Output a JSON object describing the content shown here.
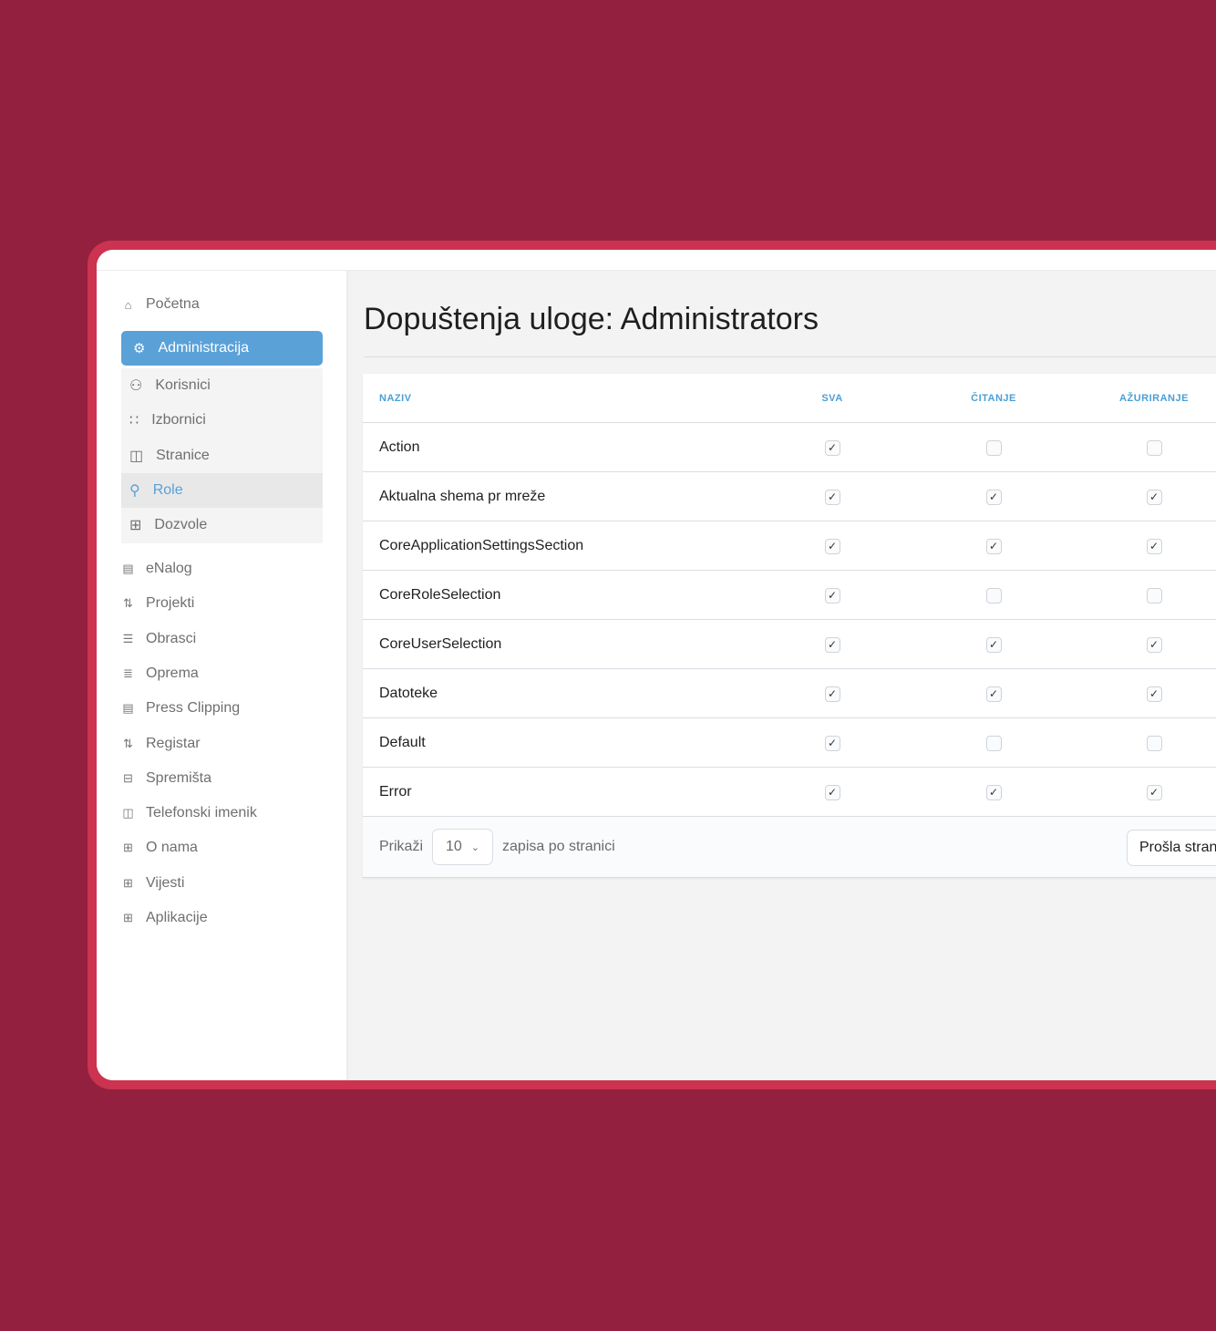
{
  "colors": {
    "background": "#93203e",
    "frame": "#cc3350",
    "accent": "#5aa1d8"
  },
  "sidebar": {
    "home": {
      "label": "Početna",
      "icon": "home-icon"
    },
    "active": {
      "label": "Administracija",
      "icon": "gear-icon"
    },
    "sub": [
      {
        "label": "Korisnici",
        "icon": "users-icon"
      },
      {
        "label": "Izbornici",
        "icon": "circles-grid-icon"
      },
      {
        "label": "Stranice",
        "icon": "book-icon"
      },
      {
        "label": "Role",
        "icon": "user-gear-icon",
        "selected": true
      },
      {
        "label": "Dozvole",
        "icon": "grid-icon"
      }
    ],
    "items": [
      {
        "label": "eNalog",
        "icon": "clipboard-icon"
      },
      {
        "label": "Projekti",
        "icon": "flow-icon"
      },
      {
        "label": "Obrasci",
        "icon": "forms-icon"
      },
      {
        "label": "Oprema",
        "icon": "database-icon"
      },
      {
        "label": "Press Clipping",
        "icon": "clipboard-icon"
      },
      {
        "label": "Registar",
        "icon": "flow-icon"
      },
      {
        "label": "Spremišta",
        "icon": "archive-icon"
      },
      {
        "label": "Telefonski imenik",
        "icon": "book-icon"
      },
      {
        "label": "O nama",
        "icon": "grid-icon"
      },
      {
        "label": "Vijesti",
        "icon": "grid-icon"
      },
      {
        "label": "Aplikacije",
        "icon": "grid-icon"
      }
    ]
  },
  "main": {
    "title": "Dopuštenja uloge: Administrators",
    "table": {
      "headers": [
        "NAZIV",
        "SVA",
        "ČITANJE",
        "AŽURIRANJE"
      ],
      "rows": [
        {
          "name": "Action",
          "sva": true,
          "citanje": false,
          "azuriranje": false
        },
        {
          "name": "Aktualna shema pr mreže",
          "sva": true,
          "citanje": true,
          "azuriranje": true
        },
        {
          "name": "CoreApplicationSettingsSection",
          "sva": true,
          "citanje": true,
          "azuriranje": true
        },
        {
          "name": "CoreRoleSelection",
          "sva": true,
          "citanje": false,
          "azuriranje": false
        },
        {
          "name": "CoreUserSelection",
          "sva": true,
          "citanje": true,
          "azuriranje": true
        },
        {
          "name": "Datoteke",
          "sva": true,
          "citanje": true,
          "azuriranje": true
        },
        {
          "name": "Default",
          "sva": true,
          "citanje": false,
          "azuriranje": false
        },
        {
          "name": "Error",
          "sva": true,
          "citanje": true,
          "azuriranje": true
        }
      ]
    },
    "footer": {
      "show_label": "Prikaži",
      "page_size": "10",
      "per_page_label": "zapisa po stranici",
      "prev_label": "Prošla stranica"
    }
  }
}
